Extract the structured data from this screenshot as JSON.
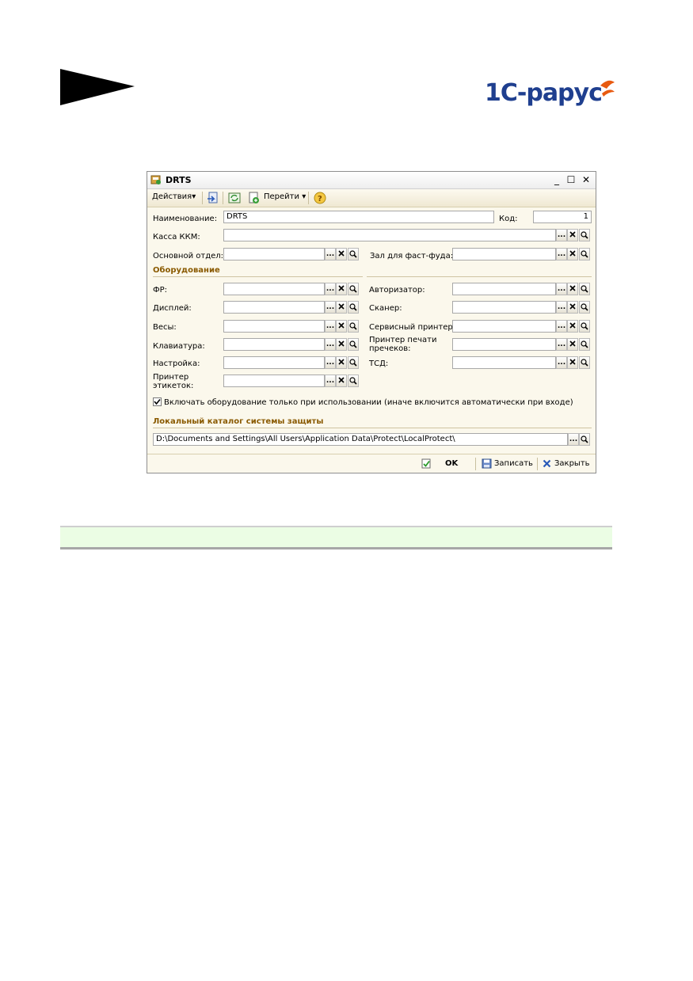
{
  "logo": {
    "text": "1С-рарус"
  },
  "window": {
    "title": "DRTS",
    "controls": {
      "minimize": "_",
      "maximize": "☐",
      "close": "✕"
    }
  },
  "toolbar": {
    "actions": "Действия",
    "goto": "Перейти",
    "dropdown": "▾"
  },
  "form": {
    "name_label": "Наименование:",
    "name_value": "DRTS",
    "code_label": "Код:",
    "code_value": "1",
    "kkm_label": "Касса ККМ:",
    "dept_label": "Основной отдел:",
    "hall_label": "Зал для фаст-фуда:",
    "equipment_section": "Оборудование",
    "left": {
      "fr": "ФР:",
      "display": "Дисплей:",
      "scales": "Весы:",
      "keyboard": "Клавиатура:",
      "settings": "Настройка:",
      "label_printer": "Принтер этикеток:"
    },
    "right": {
      "authorizer": "Авторизатор:",
      "scanner": "Сканер:",
      "service_printer": "Сервисный принтер:",
      "precheck_printer": "Принтер печати пречеков:",
      "tsd": "ТСД:"
    },
    "checkbox_label": "Включать оборудование только при использовании (иначе включится автоматически при входе)",
    "checkbox_checked": true,
    "protect_section": "Локальный каталог системы защиты",
    "protect_path": "D:\\Documents and Settings\\All Users\\Application Data\\Protect\\LocalProtect\\"
  },
  "buttons": {
    "ellipsis": "...",
    "ok": "OK",
    "save": "Записать",
    "close": "Закрыть"
  }
}
